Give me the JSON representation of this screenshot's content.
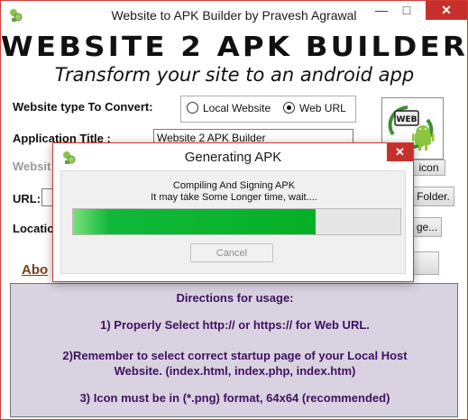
{
  "window": {
    "title": "Website to APK Builder by Pravesh Agrawal",
    "minimize": "—",
    "maximize": "□",
    "close": "✕"
  },
  "banner": {
    "title": "WEBSITE 2 APK BUILDER",
    "subtitle": "Transform your site to an android app"
  },
  "form": {
    "website_type_label": "Website type To Convert:",
    "radio_local": "Local Website",
    "radio_web": "Web URL",
    "selected_type": "Web URL",
    "app_title_label": "Application Title :",
    "app_title_value": "Website 2 APK Builder",
    "website_label_partial": "Websit",
    "url_label": "URL:",
    "location_label_partial": "Locatio",
    "choose_icon_partial": "icon",
    "folder_button_partial": "Folder.",
    "location_button_partial": "ge...",
    "icon_badge": "WEB"
  },
  "about": {
    "label_partial": "Abo"
  },
  "directions": {
    "heading": "Directions for usage:",
    "line1": "1) Properly Select http:// or https:// for Web URL.",
    "line2a": "2)Remember to select correct startup page of your Local Host",
    "line2b": "Website.  (index.html, index.php, index.htm)",
    "line3": "3) Icon must be in (*.png) format, 64x64 (recommended)"
  },
  "modal": {
    "title": "Generating APK",
    "message_line1": "Compiling And Signing APK",
    "message_line2": "It may take Some Longer time, wait....",
    "progress_percent": 74,
    "cancel_label": "Cancel",
    "close": "✕"
  },
  "colors": {
    "accent_red": "#c7302a",
    "progress_green": "#06b025",
    "directions_bg": "#d9d2e1",
    "directions_text": "#3f1160",
    "about_link": "#7a3d1c"
  }
}
